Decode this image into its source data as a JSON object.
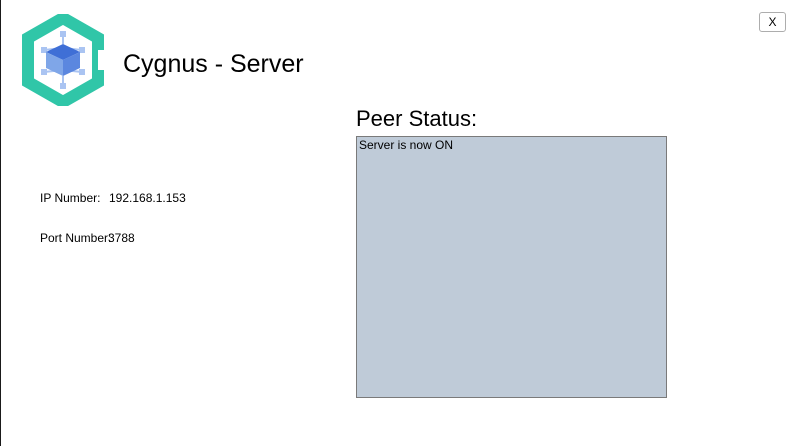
{
  "window": {
    "title": "Cygnus - Server",
    "close_label": "X"
  },
  "logo": {
    "icon": "cygnus-logo-icon",
    "colors": {
      "hex": "#30c6a8",
      "cube_top": "#3f6fd6",
      "cube_side": "#7fa6e8",
      "nodes": "#aac4f2"
    }
  },
  "server_info": {
    "ip_label": "IP Number:",
    "ip_value": "192.168.1.153",
    "port_label": "Port Number:",
    "port_value": "3788"
  },
  "peer_status": {
    "title": "Peer Status:",
    "lines": [
      "Server is now ON"
    ],
    "background": "#bfcbd8"
  }
}
